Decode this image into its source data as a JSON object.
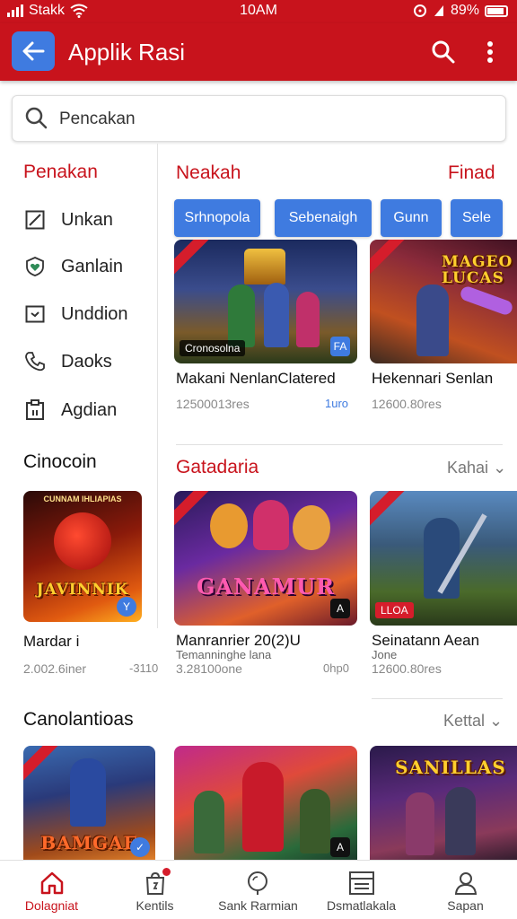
{
  "status": {
    "carrier": "Stakk",
    "time": "10AM",
    "battery": "89%"
  },
  "appbar": {
    "title": "Applik Rasi"
  },
  "search": {
    "placeholder": "Pencakan"
  },
  "sidebar": {
    "title": "Penakan",
    "items": [
      {
        "label": "Unkan",
        "icon": "square-slash-icon"
      },
      {
        "label": "Ganlain",
        "icon": "heart-shield-icon"
      },
      {
        "label": "Unddion",
        "icon": "inbox-icon"
      },
      {
        "label": "Daoks",
        "icon": "phone-icon"
      },
      {
        "label": "Agdian",
        "icon": "clipboard-icon"
      }
    ]
  },
  "section1": {
    "title": "Neakah",
    "link": "Finad",
    "chips": [
      "Srhnopola",
      "Sebenaigh",
      "Gunn",
      "Sele"
    ],
    "cards": [
      {
        "title": "Makani NenlanClatered",
        "meta": "12500013res",
        "extra": "1uro",
        "badge": "FA",
        "art_label": "Cronosolna"
      },
      {
        "title": "Hekennari Senlan",
        "meta": "12600.80res",
        "art_title": "MAGEO LUCAS"
      }
    ]
  },
  "left_section1": {
    "title": "Cinocoin",
    "card": {
      "title": "Mardar i",
      "meta": "2.002.6iner",
      "extra": "-3110",
      "art_title": "JAVINNIK",
      "art_top": "CUNNAM IHLIAPIAS",
      "badge": "Y"
    }
  },
  "section2": {
    "title": "Gatadaria",
    "link": "Kahai",
    "cards": [
      {
        "title": "Manranrier 20(2)U",
        "subtitle": "Temanninghe lana",
        "meta": "3.28100one",
        "extra": "0hp0",
        "art_title": "GANAMUR",
        "badge": "A"
      },
      {
        "title": "Seinatann Aean",
        "subtitle": "Jone",
        "meta": "12600.80res",
        "art_label": "LLOA"
      }
    ]
  },
  "section3": {
    "title": "Canolantioas",
    "link": "Kettal",
    "cards": [
      {
        "art_title": "BAMGAE"
      },
      {
        "badge": "A"
      },
      {
        "art_title": "SANILLAS"
      }
    ]
  },
  "bottom_nav": [
    {
      "label": "Dolagniat",
      "icon": "home-icon",
      "active": true
    },
    {
      "label": "Kentils",
      "icon": "store-icon"
    },
    {
      "label": "Sank Rarmian",
      "icon": "search-icon"
    },
    {
      "label": "Dsmatlakala",
      "icon": "list-icon"
    },
    {
      "label": "Sapan",
      "icon": "profile-icon"
    }
  ],
  "colors": {
    "primary": "#c8131c",
    "accent": "#3f7be0"
  }
}
